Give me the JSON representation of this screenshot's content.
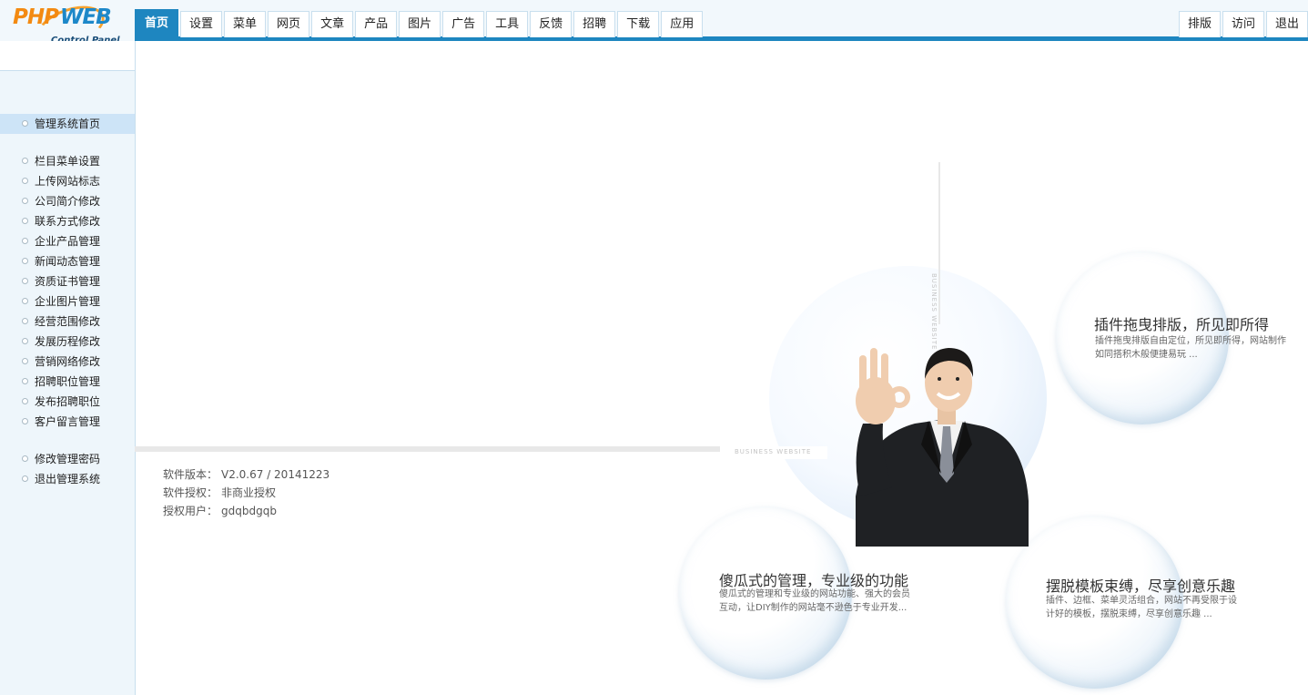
{
  "logo": {
    "php": "PHP",
    "web": "WEB",
    "subtitle": "Control Panel"
  },
  "nav": {
    "tabs": [
      "首页",
      "设置",
      "菜单",
      "网页",
      "文章",
      "产品",
      "图片",
      "广告",
      "工具",
      "反馈",
      "招聘",
      "下载",
      "应用"
    ],
    "right": [
      "排版",
      "访问",
      "退出"
    ]
  },
  "sidebar": {
    "home": "管理系统首页",
    "items": [
      "栏目菜单设置",
      "上传网站标志",
      "公司简介修改",
      "联系方式修改",
      "企业产品管理",
      "新闻动态管理",
      "资质证书管理",
      "企业图片管理",
      "经营范围修改",
      "发展历程修改",
      "营销网络修改",
      "招聘职位管理",
      "发布招聘职位",
      "客户留言管理"
    ],
    "bottom": [
      "修改管理密码",
      "退出管理系统"
    ]
  },
  "info": {
    "version_label": "软件版本：",
    "version_value": "V2.0.67 / 20141223",
    "license_label": "软件授权：",
    "license_value": "非商业授权",
    "user_label": "授权用户：",
    "user_value": "gdqbdgqb"
  },
  "banner": {
    "watermark": "BUSINESS WEBSITE",
    "feature1": {
      "title": "插件拖曳排版，所见即所得",
      "desc": "插件拖曳排版自由定位，所见即所得，网站制作如同搭积木般便捷易玩 ..."
    },
    "feature2": {
      "title": "傻瓜式的管理，专业级的功能",
      "desc": "傻瓜式的管理和专业级的网站功能、强大的会员互动，让DIY制作的网站毫不逊色于专业开发..."
    },
    "feature3": {
      "title": "摆脱模板束缚，尽享创意乐趣",
      "desc": "插件、边框、菜单灵活组合，网站不再受限于设计好的模板，摆脱束缚，尽享创意乐趣 ..."
    }
  },
  "colors": {
    "accent": "#1e86c0",
    "sidebar_bg": "#eef6fb",
    "active_item": "#cde4f7"
  }
}
